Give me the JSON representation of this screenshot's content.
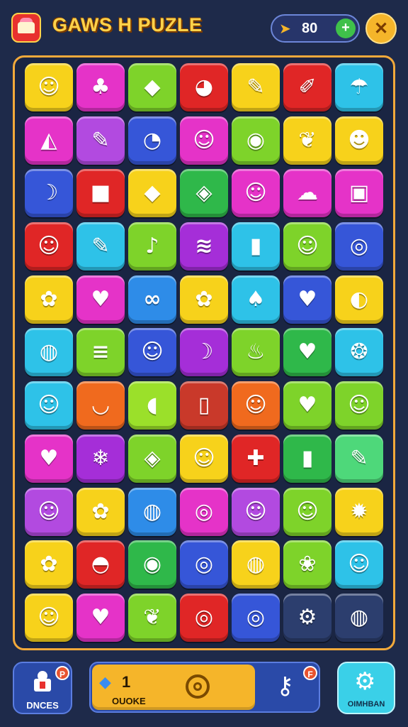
{
  "header": {
    "title": "GAWS H PUZLE",
    "coins": "80",
    "coin_icon": "lightning-bolt-icon",
    "add_symbol": "+",
    "close_symbol": "✕"
  },
  "board": {
    "rows": [
      [
        {
          "c": "#f7d21b",
          "g": "☺",
          "n": "smiley-face-icon"
        },
        {
          "c": "#e533c8",
          "g": "♣",
          "n": "crab-icon"
        },
        {
          "c": "#7ed32a",
          "g": "◆",
          "n": "fish-icon"
        },
        {
          "c": "#e02626",
          "g": "◕",
          "n": "bird-icon"
        },
        {
          "c": "#f7d21b",
          "g": "✎",
          "n": "pencil-icon"
        },
        {
          "c": "#e02626",
          "g": "✐",
          "n": "marker-icon"
        },
        {
          "c": "#2ec2e8",
          "g": "☂",
          "n": "shell-icon"
        }
      ],
      [
        {
          "c": "#e533c8",
          "g": "◭",
          "n": "crystal-icon"
        },
        {
          "c": "#b24ae0",
          "g": "✎",
          "n": "crayon-icon"
        },
        {
          "c": "#3656d8",
          "g": "◔",
          "n": "moon-icon"
        },
        {
          "c": "#e533c8",
          "g": "☺",
          "n": "monster-face-icon"
        },
        {
          "c": "#7ed32a",
          "g": "◉",
          "n": "leaf-icon"
        },
        {
          "c": "#f7d21b",
          "g": "❦",
          "n": "feather-icon"
        },
        {
          "c": "#f7d21b",
          "g": "☻",
          "n": "baby-face-icon"
        }
      ],
      [
        {
          "c": "#3656d8",
          "g": "☽",
          "n": "banana-icon"
        },
        {
          "c": "#e02626",
          "g": "■",
          "n": "cube-icon"
        },
        {
          "c": "#f7d21b",
          "g": "◆",
          "n": "candy-icon"
        },
        {
          "c": "#2fb84a",
          "g": "◈",
          "n": "carrot-icon"
        },
        {
          "c": "#e533c8",
          "g": "☺",
          "n": "devil-face-icon"
        },
        {
          "c": "#e533c8",
          "g": "☁",
          "n": "cupcake-icon"
        },
        {
          "c": "#e533c8",
          "g": "▣",
          "n": "box-icon"
        }
      ],
      [
        {
          "c": "#e02626",
          "g": "☺",
          "n": "tomato-face-icon"
        },
        {
          "c": "#2ec2e8",
          "g": "✎",
          "n": "brush-icon"
        },
        {
          "c": "#7ed32a",
          "g": "♪",
          "n": "microphone-icon"
        },
        {
          "c": "#a52ed8",
          "g": "≋",
          "n": "wave-icon"
        },
        {
          "c": "#2ec2e8",
          "g": "▮",
          "n": "jar-icon"
        },
        {
          "c": "#7ed32a",
          "g": "☺",
          "n": "cat-face-icon"
        },
        {
          "c": "#3656d8",
          "g": "◎",
          "n": "orb-icon"
        }
      ],
      [
        {
          "c": "#f7d21b",
          "g": "✿",
          "n": "flower-icon"
        },
        {
          "c": "#e533c8",
          "g": "♥",
          "n": "heart-icon"
        },
        {
          "c": "#2e8ce8",
          "g": "∞",
          "n": "bone-icon"
        },
        {
          "c": "#f7d21b",
          "g": "✿",
          "n": "gear-flower-icon"
        },
        {
          "c": "#2ec2e8",
          "g": "♠",
          "n": "pear-icon"
        },
        {
          "c": "#3656d8",
          "g": "♥",
          "n": "heart-gem-icon"
        },
        {
          "c": "#f7d21b",
          "g": "◐",
          "n": "blob-icon"
        }
      ],
      [
        {
          "c": "#2ec2e8",
          "g": "◍",
          "n": "egg-icon"
        },
        {
          "c": "#7ed32a",
          "g": "≡",
          "n": "burger-icon"
        },
        {
          "c": "#3656d8",
          "g": "☺",
          "n": "pot-face-icon"
        },
        {
          "c": "#a52ed8",
          "g": "☽",
          "n": "banana-bunch-icon"
        },
        {
          "c": "#7ed32a",
          "g": "♨",
          "n": "stool-icon"
        },
        {
          "c": "#2fb84a",
          "g": "♥",
          "n": "red-heart-icon"
        },
        {
          "c": "#2ec2e8",
          "g": "❂",
          "n": "football-icon"
        }
      ],
      [
        {
          "c": "#2ec2e8",
          "g": "☺",
          "n": "turtle-icon"
        },
        {
          "c": "#f06a1e",
          "g": "◡",
          "n": "bowl-icon"
        },
        {
          "c": "#9be02a",
          "g": "◖",
          "n": "bean-icon"
        },
        {
          "c": "#c9392a",
          "g": "▯",
          "n": "bottle-icon"
        },
        {
          "c": "#f06a1e",
          "g": "☺",
          "n": "cup-face-icon"
        },
        {
          "c": "#7ed32a",
          "g": "♥",
          "n": "pink-heart-icon"
        },
        {
          "c": "#7ed32a",
          "g": "☺",
          "n": "orange-face-icon"
        }
      ],
      [
        {
          "c": "#e533c8",
          "g": "♥",
          "n": "yellow-heart-icon"
        },
        {
          "c": "#a52ed8",
          "g": "❄",
          "n": "ice-cream-icon"
        },
        {
          "c": "#7ed32a",
          "g": "◈",
          "n": "pepper-icon"
        },
        {
          "c": "#f7d21b",
          "g": "☺",
          "n": "octopus-icon"
        },
        {
          "c": "#e02626",
          "g": "✚",
          "n": "leaf-knife-icon"
        },
        {
          "c": "#2fb84a",
          "g": "▮",
          "n": "can-icon"
        },
        {
          "c": "#4ed87a",
          "g": "✎",
          "n": "pencil-gold-icon"
        }
      ],
      [
        {
          "c": "#b24ae0",
          "g": "☺",
          "n": "jelly-icon"
        },
        {
          "c": "#f7d21b",
          "g": "✿",
          "n": "daisy-icon"
        },
        {
          "c": "#2e8ce8",
          "g": "◍",
          "n": "ball-icon"
        },
        {
          "c": "#e533c8",
          "g": "◎",
          "n": "swirl-icon"
        },
        {
          "c": "#b24ae0",
          "g": "☺",
          "n": "pumpkin-face-icon"
        },
        {
          "c": "#7ed32a",
          "g": "☺",
          "n": "mushroom-icon"
        },
        {
          "c": "#f7d21b",
          "g": "✹",
          "n": "splat-icon"
        }
      ],
      [
        {
          "c": "#f7d21b",
          "g": "✿",
          "n": "sunflower-icon"
        },
        {
          "c": "#e02626",
          "g": "◓",
          "n": "melon-icon"
        },
        {
          "c": "#2fb84a",
          "g": "◉",
          "n": "eggplant-icon"
        },
        {
          "c": "#3656d8",
          "g": "◎",
          "n": "ring-icon"
        },
        {
          "c": "#f7d21b",
          "g": "◍",
          "n": "beach-ball-icon"
        },
        {
          "c": "#7ed32a",
          "g": "❀",
          "n": "donut-icon"
        },
        {
          "c": "#2ec2e8",
          "g": "☺",
          "n": "orange-smile-icon"
        }
      ],
      [
        {
          "c": "#f7d21b",
          "g": "☺",
          "n": "blue-fish-icon"
        },
        {
          "c": "#e533c8",
          "g": "♥",
          "n": "blue-heart-icon"
        },
        {
          "c": "#7ed32a",
          "g": "❦",
          "n": "leaf-flower-icon"
        },
        {
          "c": "#e02626",
          "g": "◎",
          "n": "spiral-icon"
        },
        {
          "c": "#3656d8",
          "g": "◎",
          "n": "blue-ring-icon"
        },
        {
          "c": "#2c3e6e",
          "g": "⚙",
          "n": "dark-gear-icon"
        },
        {
          "c": "#2c3e6e",
          "g": "◍",
          "n": "dark-cookie-icon"
        }
      ]
    ]
  },
  "footer": {
    "left_label": "DNCES",
    "left_badge": "P",
    "count": "1",
    "center_label": "OUOKE",
    "key_badge": "F",
    "right_label": "OIMHBAN"
  },
  "colors": {
    "accent": "#f5b52a",
    "board_border": "#f2a93b",
    "background": "#1e2a4a"
  }
}
